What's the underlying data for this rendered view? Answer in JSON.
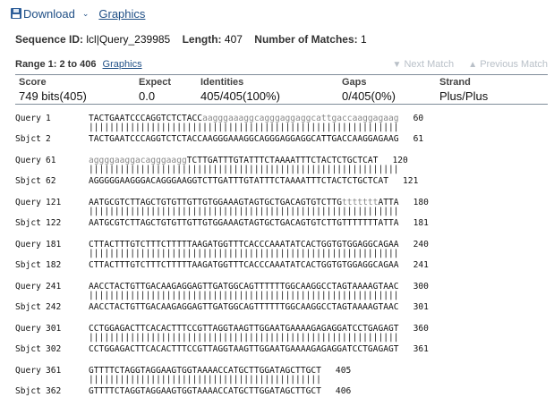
{
  "toolbar": {
    "download_label": "Download",
    "dropdown_caret": "⌄",
    "graphics_label": "Graphics"
  },
  "sequence": {
    "id_label": "Sequence ID:",
    "id_value": "lcl|Query_239985",
    "length_label": "Length:",
    "length_value": "407",
    "matches_label": "Number of Matches:",
    "matches_value": "1"
  },
  "range": {
    "label": "Range 1: 2 to 406",
    "graphics_label": "Graphics",
    "next_match": "Next Match",
    "previous_match": "Previous Match"
  },
  "scores": {
    "score_label": "Score",
    "score_value": "749 bits(405)",
    "expect_label": "Expect",
    "expect_value": "0.0",
    "identities_label": "Identities",
    "identities_value": "405/405(100%)",
    "gaps_label": "Gaps",
    "gaps_value": "0/405(0%)",
    "strand_label": "Strand",
    "strand_value": "Plus/Plus"
  },
  "alignment": {
    "query_label": "Query",
    "sbjct_label": "Sbjct",
    "blocks": [
      {
        "q_start": "1",
        "q_upper": "TACTGAATCCCAGGTCTCTACC",
        "q_lower": "aagggaaaggcagggaggaggcattgaccaaggagaag",
        "q_tail": "",
        "q_end": "60",
        "match": "||||||||||||||||||||||||||||||||||||||||||||||||||||||||||||",
        "s_start": "2",
        "s_seq": "TACTGAATCCCAGGTCTCTACCAAGGGAAAGGCAGGGAGGAGGCATTGACCAAGGAGAAG",
        "s_end": "61"
      },
      {
        "q_start": "61",
        "q_upper": "",
        "q_lower": "aggggaaggacagggaagg",
        "q_tail": "TCTTGATTTGTATTTCTAAAATTTCTACTCTGCTCAT",
        "q_end": "120",
        "match": "||||||||||||||||||||||||||||||||||||||||||||||||||||||||||||",
        "s_start": "62",
        "s_seq": "AGGGGGAAGGGACAGGGAAGGTCTTGATTTGTATTTCTAAAATTTCTACTCTGCTCAT",
        "s_end": "121"
      },
      {
        "q_start": "121",
        "q_upper": "AATGCGTCTTAGCTGTGTTGTTGTGGAAAGTAGTGCTGACAGTGTCTTG",
        "q_lower": "ttttttt",
        "q_tail": "ATTA",
        "q_end": "180",
        "match": "||||||||||||||||||||||||||||||||||||||||||||||||||||||||||||",
        "s_start": "122",
        "s_seq": "AATGCGTCTTAGCTGTGTTGTTGTGGAAAGTAGTGCTGACAGTGTCTTGTTTTTTTATTA",
        "s_end": "181"
      },
      {
        "q_start": "181",
        "q_upper": "CTTACTTTGTCTTTCTTTTTAAGATGGTTTCACCCAAATATCACTGGTGTGGAGGCAGAA",
        "q_lower": "",
        "q_tail": "",
        "q_end": "240",
        "match": "||||||||||||||||||||||||||||||||||||||||||||||||||||||||||||",
        "s_start": "182",
        "s_seq": "CTTACTTTGTCTTTCTTTTTAAGATGGTTTCACCCAAATATCACTGGTGTGGAGGCAGAA",
        "s_end": "241"
      },
      {
        "q_start": "241",
        "q_upper": "AACCTACTGTTGACAAGAGGAGTTGATGGCAGTTTTTTGGCAAGGCCTAGTAAAAGTAAC",
        "q_lower": "",
        "q_tail": "",
        "q_end": "300",
        "match": "||||||||||||||||||||||||||||||||||||||||||||||||||||||||||||",
        "s_start": "242",
        "s_seq": "AACCTACTGTTGACAAGAGGAGTTGATGGCAGTTTTTTGGCAAGGCCTAGTAAAAGTAAC",
        "s_end": "301"
      },
      {
        "q_start": "301",
        "q_upper": "CCTGGAGACTTCACACTTTCCGTTAGGTAAGTTGGAATGAAAAGAGAGGATCCTGAGAGT",
        "q_lower": "",
        "q_tail": "",
        "q_end": "360",
        "match": "||||||||||||||||||||||||||||||||||||||||||||||||||||||||||||",
        "s_start": "302",
        "s_seq": "CCTGGAGACTTCACACTTTCCGTTAGGTAAGTTGGAATGAAAAGAGAGGATCCTGAGAGT",
        "s_end": "361"
      },
      {
        "q_start": "361",
        "q_upper": "GTTTTCTAGGTAGGAAGTGGTAAAACCATGCTTGGATAGCTTGCT",
        "q_lower": "",
        "q_tail": "",
        "q_end": "405",
        "match": "|||||||||||||||||||||||||||||||||||||||||||||",
        "s_start": "362",
        "s_seq": "GTTTTCTAGGTAGGAAGTGGTAAAACCATGCTTGGATAGCTTGCT",
        "s_end": "406"
      }
    ]
  }
}
